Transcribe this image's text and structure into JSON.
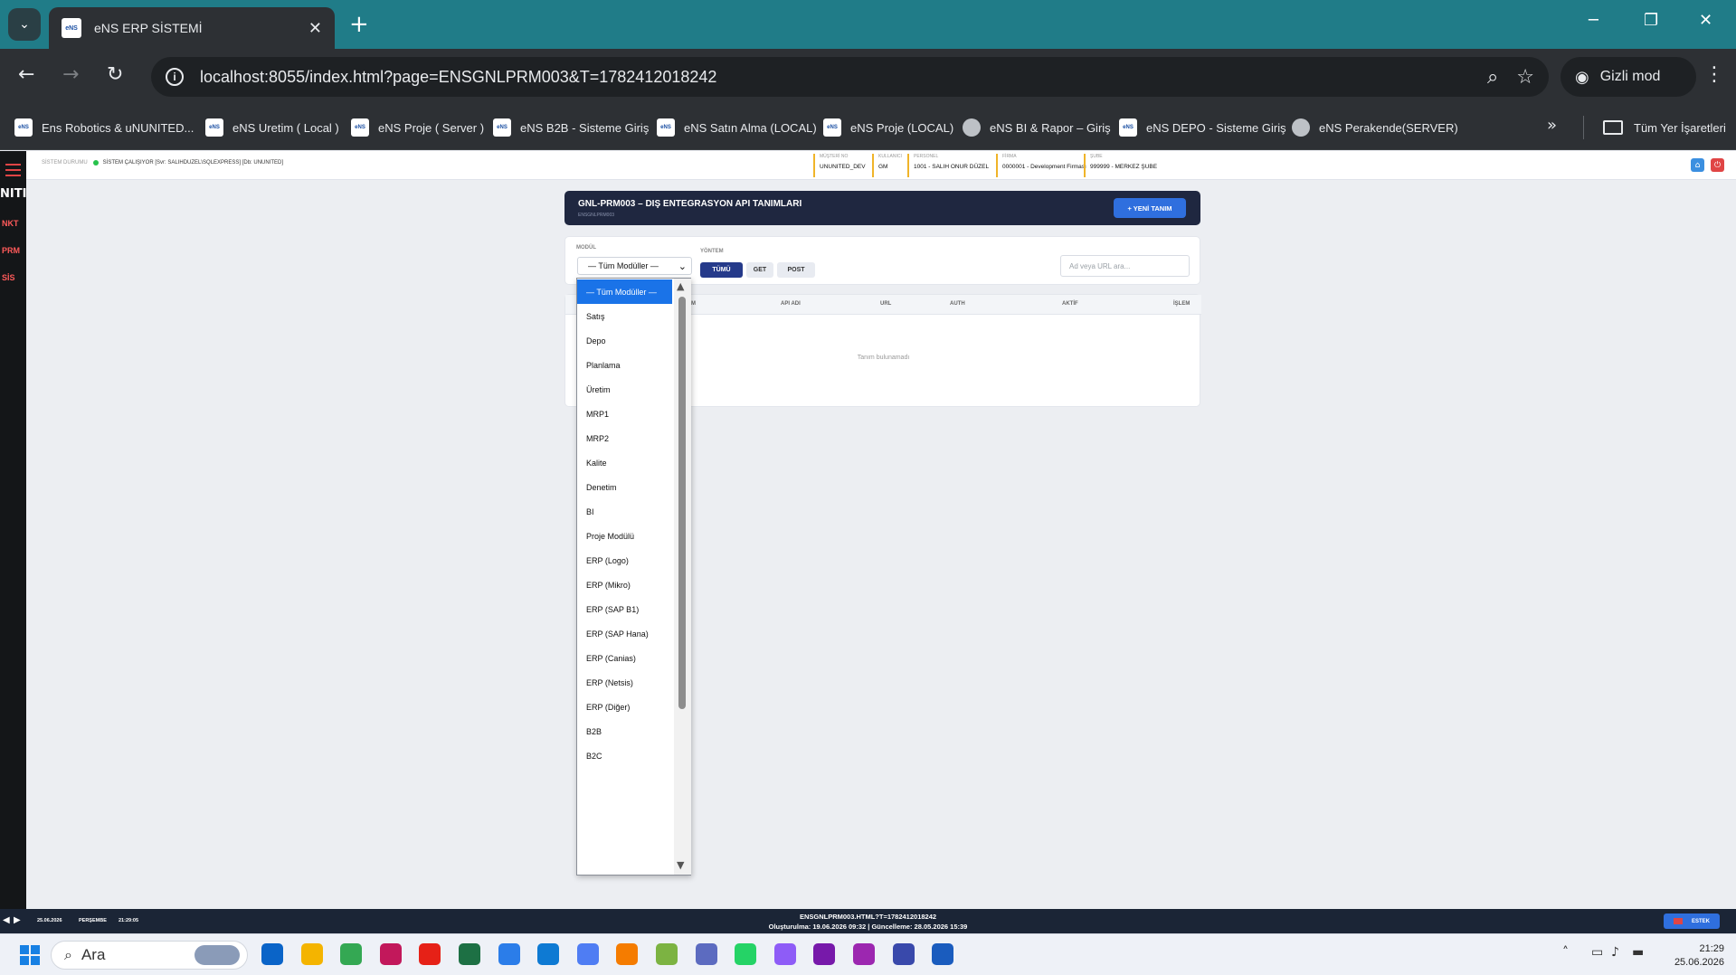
{
  "browser": {
    "tab_title": "eNS ERP SİSTEMİ",
    "url": "localhost:8055/index.html?page=ENSGNLPRM003&T=1782412018242",
    "incognito_label": "Gizli mod",
    "favicon_text": "eNS",
    "bookmarks": [
      {
        "label": "Ens Robotics & uNUNITED...",
        "icon": "ens-icon"
      },
      {
        "label": "eNS Uretim ( Local )",
        "icon": "ens-icon"
      },
      {
        "label": "eNS Proje ( Server )",
        "icon": "ens-icon"
      },
      {
        "label": "eNS B2B - Sisteme Giriş",
        "icon": "ens-icon"
      },
      {
        "label": "eNS Satın Alma (LOCAL)",
        "icon": "ens-icon"
      },
      {
        "label": "eNS Proje (LOCAL)",
        "icon": "ens-icon"
      },
      {
        "label": "eNS BI & Rapor – Giriş",
        "icon": "globe-icon"
      },
      {
        "label": "eNS DEPO - Sisteme Giriş",
        "icon": "ens-icon"
      },
      {
        "label": "eNS Perakende(SERVER)",
        "icon": "globe-icon"
      }
    ],
    "all_bookmarks_label": "Tüm Yer İşaretleri"
  },
  "sidebar": {
    "brand_fragment": "NITI",
    "codes": [
      "NKT",
      "PRM",
      "SİS"
    ]
  },
  "header": {
    "status_label": "SİSTEM DURUMU",
    "status_text": "SİSTEM ÇALIŞIYOR [Svr: SALIHDUZEL\\SQLEXPRESS] [Db: UNUNITED]",
    "cells": [
      {
        "label": "MÜŞTERİ NO",
        "value": "UNUNITED_DEV"
      },
      {
        "label": "KULLANICI",
        "value": "GM"
      },
      {
        "label": "PERSONEL",
        "value": "1001 - SALIH ONUR DÜZEL"
      },
      {
        "label": "FİRMA",
        "value": "0000001 - Development Firması"
      },
      {
        "label": "ŞUBE",
        "value": "999999 - MERKEZ ŞUBE"
      }
    ]
  },
  "page": {
    "title": "GNL-PRM003 – DIŞ ENTEGRASYON API TANIMLARI",
    "subtitle": "ENSGNLPRM003",
    "new_button": "+ YENİ TANIM",
    "filters": {
      "module_label": "MODÜL",
      "module_value": "— Tüm Modüller —",
      "method_label": "YÖNTEM",
      "methods": [
        "TÜMÜ",
        "GET",
        "POST"
      ],
      "search_placeholder": "Ad veya URL ara..."
    },
    "table": {
      "columns": [
        "M",
        "API ADI",
        "URL",
        "AUTH",
        "AKTİF",
        "İŞLEM"
      ],
      "empty_message": "Tanım bulunamadı"
    },
    "module_options": [
      "— Tüm Modüller —",
      "Satış",
      "Depo",
      "Planlama",
      "Üretim",
      "MRP1",
      "MRP2",
      "Kalite",
      "Denetim",
      "BI",
      "Proje Modülü",
      "ERP (Logo)",
      "ERP (Mikro)",
      "ERP (SAP B1)",
      "ERP (SAP Hana)",
      "ERP (Canias)",
      "ERP (Netsis)",
      "ERP (Diğer)",
      "B2B",
      "B2C"
    ]
  },
  "footer": {
    "date": "25.06.2026",
    "day": "PERŞEMBE",
    "time": "21:29:05",
    "file_line": "ENSGNLPRM003.HTML?T=1782412018242",
    "meta_line": "Oluşturulma: 19.06.2026 09:32 | Güncelleme: 28.05.2026 15:39",
    "badge": "ESTEK"
  },
  "taskbar": {
    "search_label": "Ara",
    "clock_time": "21:29",
    "clock_date": "25.06.2026",
    "apps": [
      {
        "name": "outlook-icon",
        "color": "#0a64c8"
      },
      {
        "name": "file-explorer-icon",
        "color": "#f4b400"
      },
      {
        "name": "chrome-icon",
        "color": "#34a853"
      },
      {
        "name": "snipping-tool-icon",
        "color": "#c2185b"
      },
      {
        "name": "youtube-icon",
        "color": "#e62117"
      },
      {
        "name": "excel-icon",
        "color": "#1d7044"
      },
      {
        "name": "notepad-icon",
        "color": "#2b7de9"
      },
      {
        "name": "vscode-icon",
        "color": "#0e7ad3"
      },
      {
        "name": "gemini-icon",
        "color": "#4f7df3"
      },
      {
        "name": "app-circle-icon",
        "color": "#f57c00"
      },
      {
        "name": "app-tools-icon",
        "color": "#7cb342"
      },
      {
        "name": "app-a-icon",
        "color": "#5c6bc0"
      },
      {
        "name": "whatsapp-icon",
        "color": "#25d366"
      },
      {
        "name": "copilot-icon",
        "color": "#8e5cf7"
      },
      {
        "name": "onenote-icon",
        "color": "#7719aa"
      },
      {
        "name": "app-stack-icon",
        "color": "#9c27b0"
      },
      {
        "name": "ssms-icon",
        "color": "#3949ab"
      },
      {
        "name": "word-icon",
        "color": "#1a5cbe"
      }
    ]
  }
}
